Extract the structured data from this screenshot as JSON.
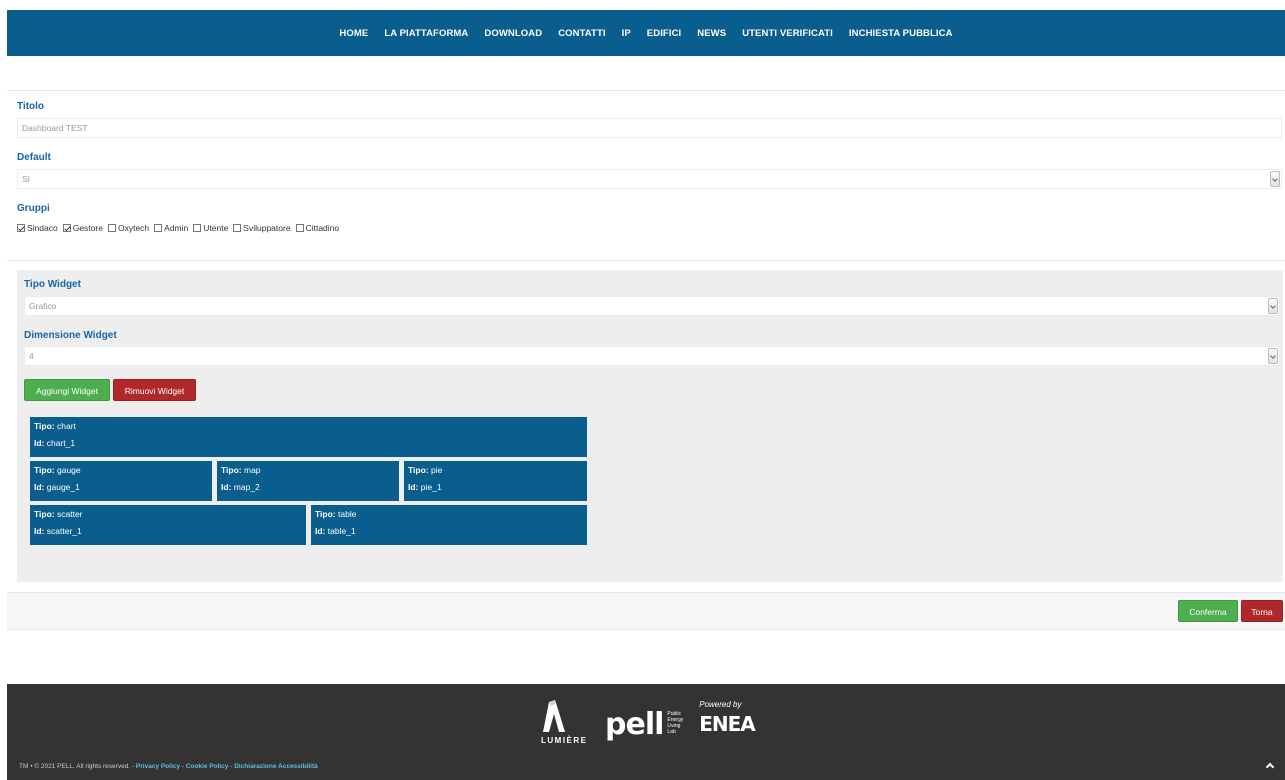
{
  "nav": {
    "items": [
      "HOME",
      "LA PIATTAFORMA",
      "DOWNLOAD",
      "CONTATTI",
      "IP",
      "EDIFICI",
      "NEWS",
      "UTENTI VERIFICATI",
      "INCHIESTA PUBBLICA"
    ]
  },
  "form": {
    "titolo_label": "Titolo",
    "titolo_value": "Dashboard TEST",
    "default_label": "Default",
    "default_value": "SI",
    "gruppi_label": "Gruppi",
    "gruppi": [
      {
        "label": "Sindaco",
        "checked": true
      },
      {
        "label": "Gestore",
        "checked": true
      },
      {
        "label": "Oxytech",
        "checked": false
      },
      {
        "label": "Admin",
        "checked": false
      },
      {
        "label": "Utente",
        "checked": false
      },
      {
        "label": "Sviluppatore",
        "checked": false
      },
      {
        "label": "Cittadino",
        "checked": false
      }
    ]
  },
  "widget_panel": {
    "tipo_label": "Tipo Widget",
    "tipo_value": "Grafico",
    "dimensione_label": "Dimensione Widget",
    "dimensione_value": "4",
    "add_button": "Aggiungi Widget",
    "remove_button": "Rimuovi Widget",
    "tipo_prefix": "Tipo:",
    "id_prefix": "Id:",
    "widgets": [
      {
        "tipo": "chart",
        "id": "chart_1"
      },
      {
        "tipo": "gauge",
        "id": "gauge_1"
      },
      {
        "tipo": "map",
        "id": "map_2"
      },
      {
        "tipo": "pie",
        "id": "pie_1"
      },
      {
        "tipo": "scatter",
        "id": "scatter_1"
      },
      {
        "tipo": "table",
        "id": "table_1"
      }
    ]
  },
  "actions": {
    "confirm": "Conferma",
    "back": "Torna"
  },
  "footer": {
    "lumiere": "LUMIÈRE",
    "pell": "pell",
    "pell_sub": [
      "Public",
      "Energy",
      "Living",
      "Lab"
    ],
    "powered_by": "Powered by",
    "enea": "ENEA",
    "copyright": "TM • © 2021 PELL. All rights reserved. -",
    "links": [
      "Privacy Policy",
      "Cookie Policy",
      "Dichiarazione Accessibilità"
    ]
  },
  "colors": {
    "primary": "#0a5e8e",
    "label": "#1565a8",
    "success": "#4cae4c",
    "danger": "#b0282a",
    "footer_bg": "#333333"
  }
}
